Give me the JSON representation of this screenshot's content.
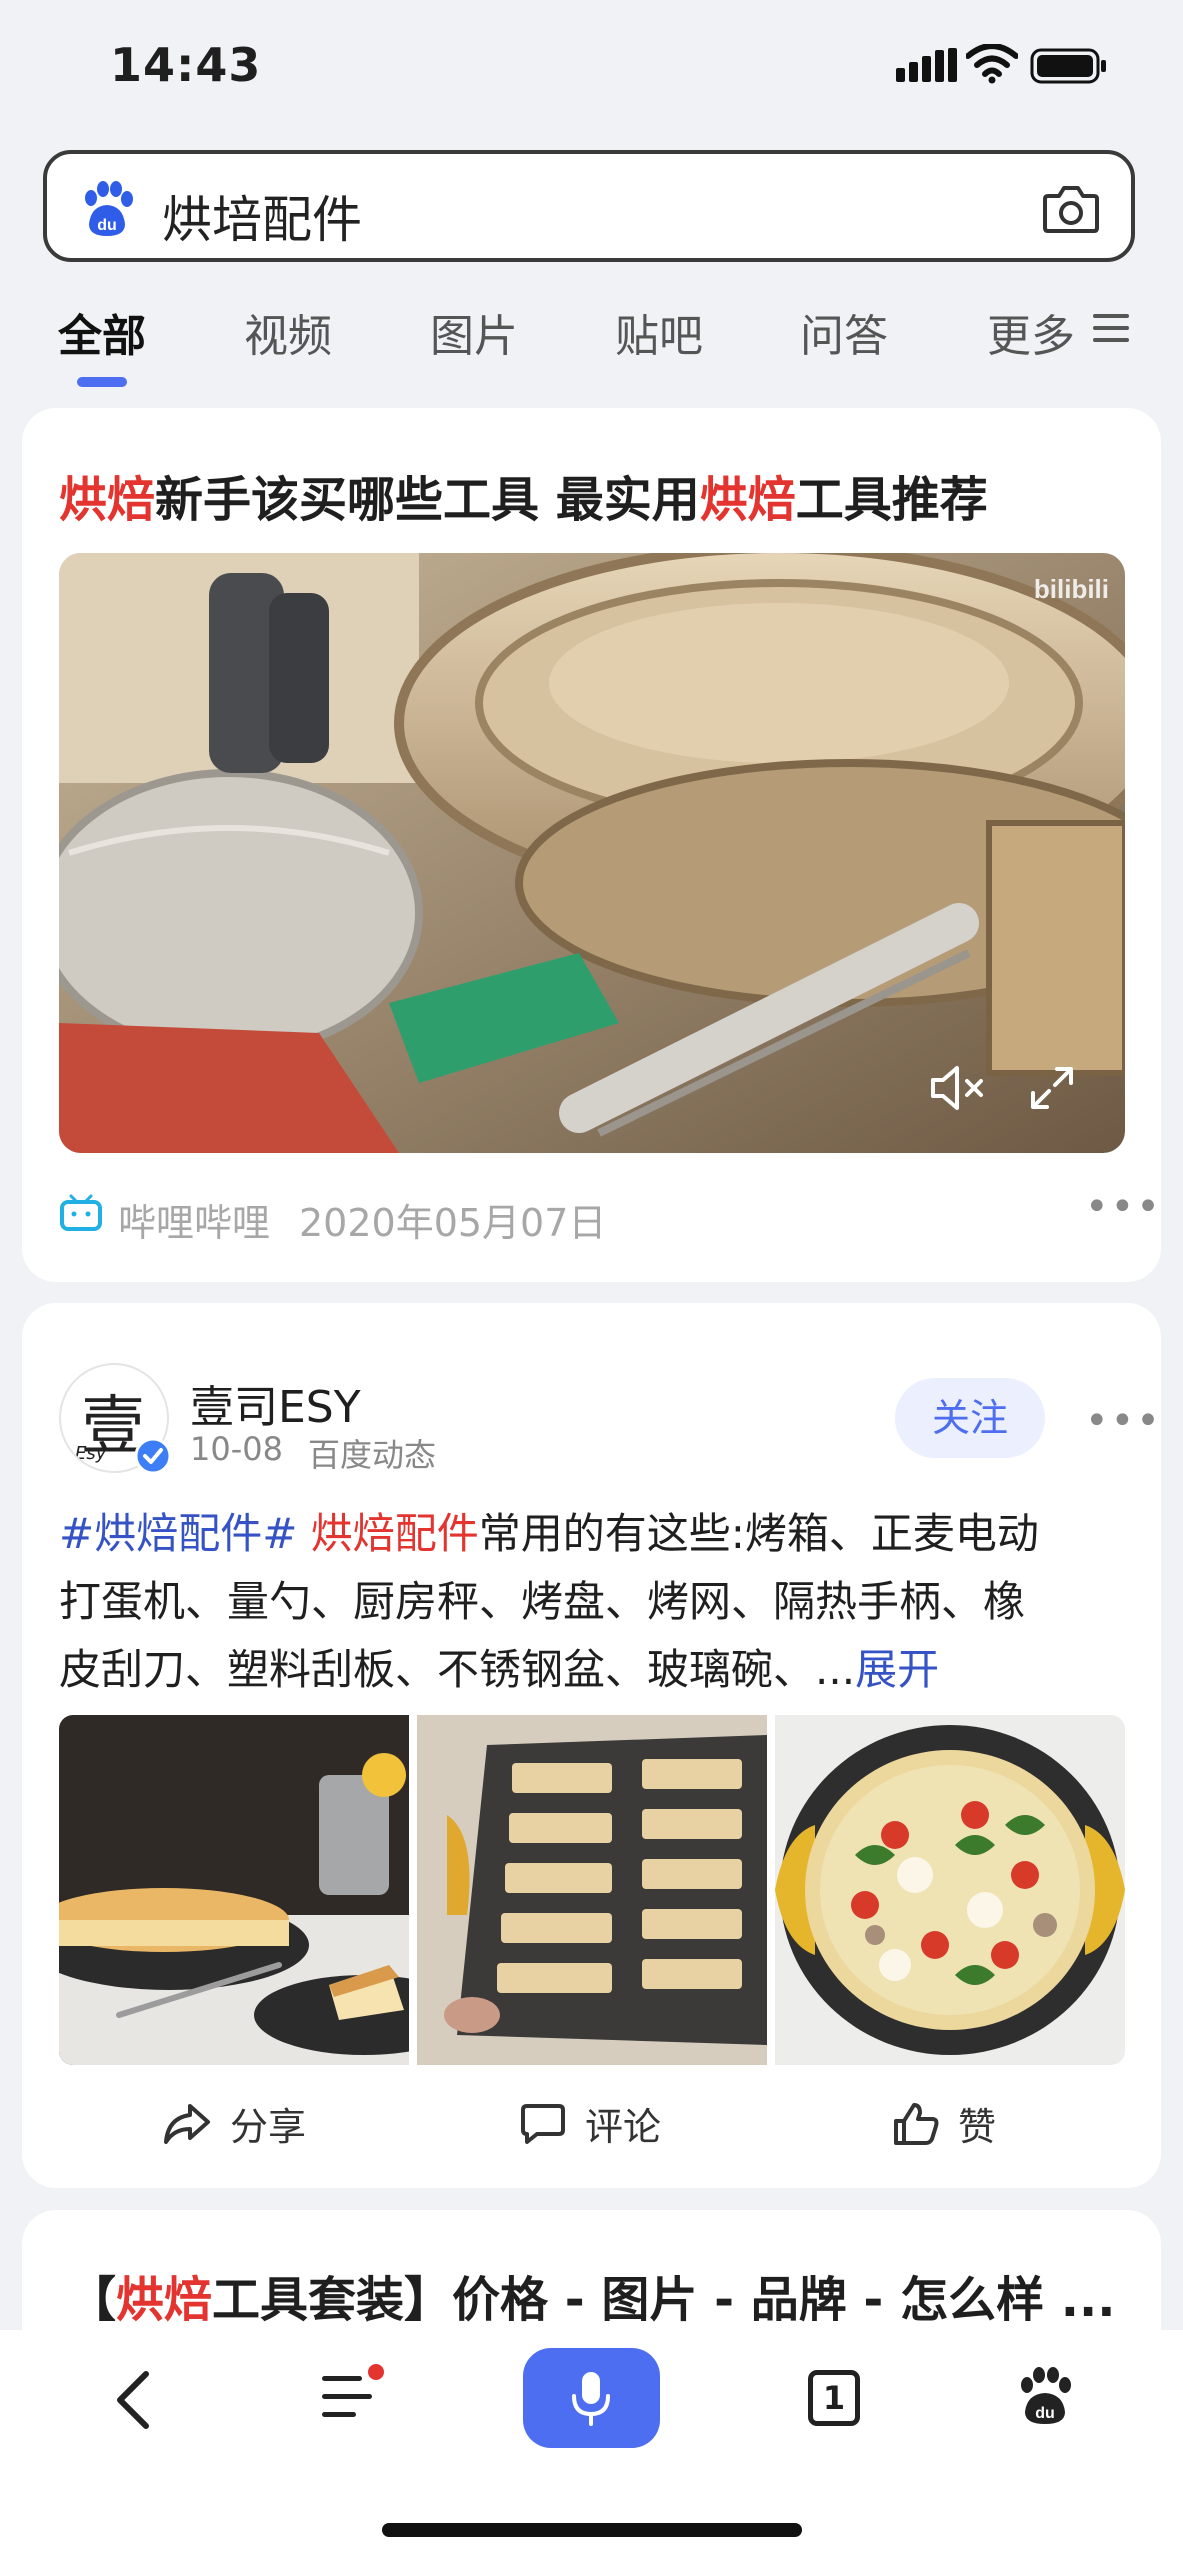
{
  "status_bar": {
    "time": "14:43"
  },
  "search": {
    "query": "烘培配件"
  },
  "tabs": [
    {
      "label": "全部"
    },
    {
      "label": "视频"
    },
    {
      "label": "图片"
    },
    {
      "label": "贴吧"
    },
    {
      "label": "问答"
    },
    {
      "label": "更多"
    }
  ],
  "result1": {
    "title_parts": [
      "烘焙",
      "新手该买哪些工具 最实用",
      "烘焙",
      "工具推荐"
    ],
    "source": "哔哩哔哩",
    "date": "2020年05月07日",
    "watermark": "bilibili"
  },
  "result2": {
    "account_name": "壹司ESY",
    "avatar_text": "壹",
    "avatar_sub": "Esy",
    "date": "10-08",
    "source": "百度动态",
    "follow_label": "关注",
    "hashtag": "#烘焙配件#",
    "highlight": "烘焙配件",
    "body_l1": "常用的有这些:烤箱、正麦电动",
    "body_l2": "打蛋机、量勺、厨房秤、烤盘、烤网、隔热手柄、橡",
    "body_l3": "皮刮刀、塑料刮板、不锈钢盆、玻璃碗、...",
    "expand_label": "展开",
    "share_label": "分享",
    "comment_label": "评论",
    "like_label": "赞"
  },
  "result3": {
    "title_parts": [
      "【",
      "烘焙",
      "工具套装】价格 - 图片 - 品牌 - 怎么样 ..."
    ]
  },
  "bottom_nav": {
    "tab_count": "1"
  },
  "colors": {
    "accent": "#4e6ef2",
    "highlight": "#e3342f",
    "link": "#3553c5"
  }
}
